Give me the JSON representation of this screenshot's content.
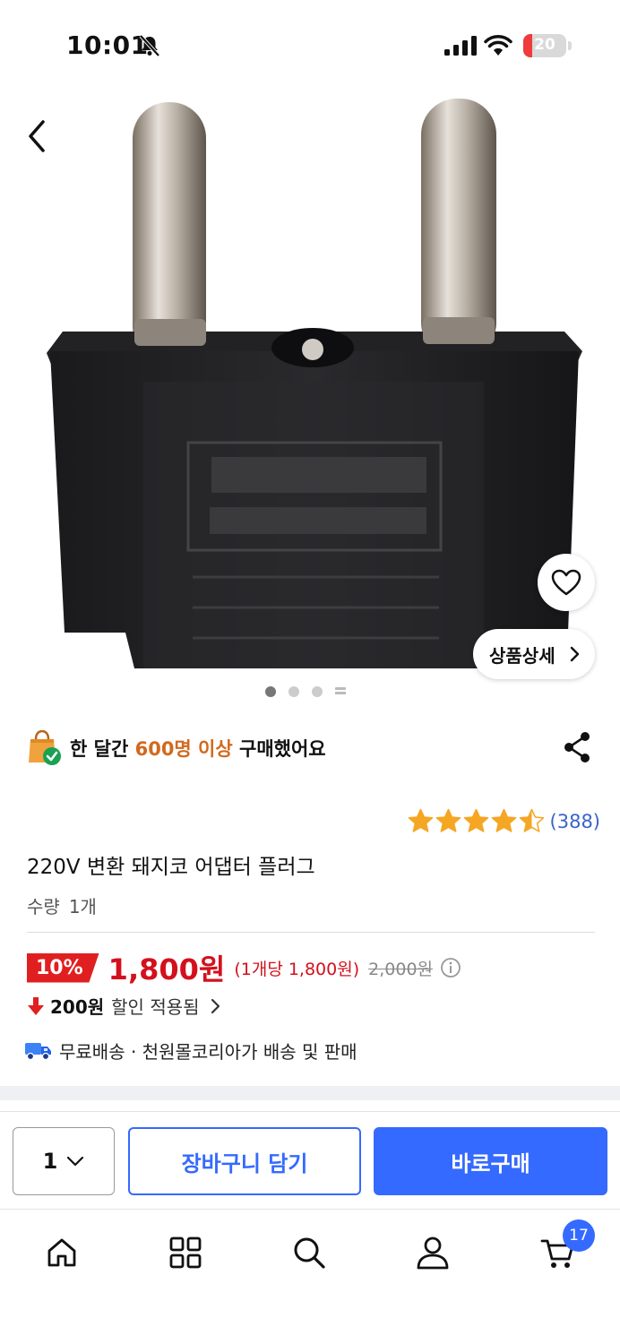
{
  "status_bar": {
    "time": "10:01",
    "battery": "20",
    "battery_level": 0.2
  },
  "product": {
    "detail_button": "상품상세",
    "carousel_pages": 4,
    "carousel_active": 0
  },
  "purchase": {
    "pre": "한 달간 ",
    "highlight": "600명 이상",
    "post": " 구매했어요"
  },
  "rating": {
    "stars": 4.5,
    "reviews": "(388)"
  },
  "title": "220V 변환 돼지코 어댑터 플러그",
  "quantity": {
    "label": "수량",
    "value": "1개"
  },
  "price": {
    "discount": "10%",
    "sale": "1,800원",
    "unit": "(1개당 1,800원)",
    "original": "2,000원"
  },
  "discount_info": {
    "amount": "200원",
    "text": "할인 적용됨"
  },
  "shipping": "무료배송 · 천원몰코리아가 배송 및 판매",
  "action_bar": {
    "qty": "1",
    "cart": "장바구니 담기",
    "buy": "바로구매"
  },
  "bottom_nav": {
    "items": [
      "home-icon",
      "category-icon",
      "search-icon",
      "user-icon",
      "cart-icon"
    ],
    "cart_count": "17"
  },
  "colors": {
    "accent": "#346aff",
    "price_red": "#d4101c",
    "star": "#f5a623"
  }
}
